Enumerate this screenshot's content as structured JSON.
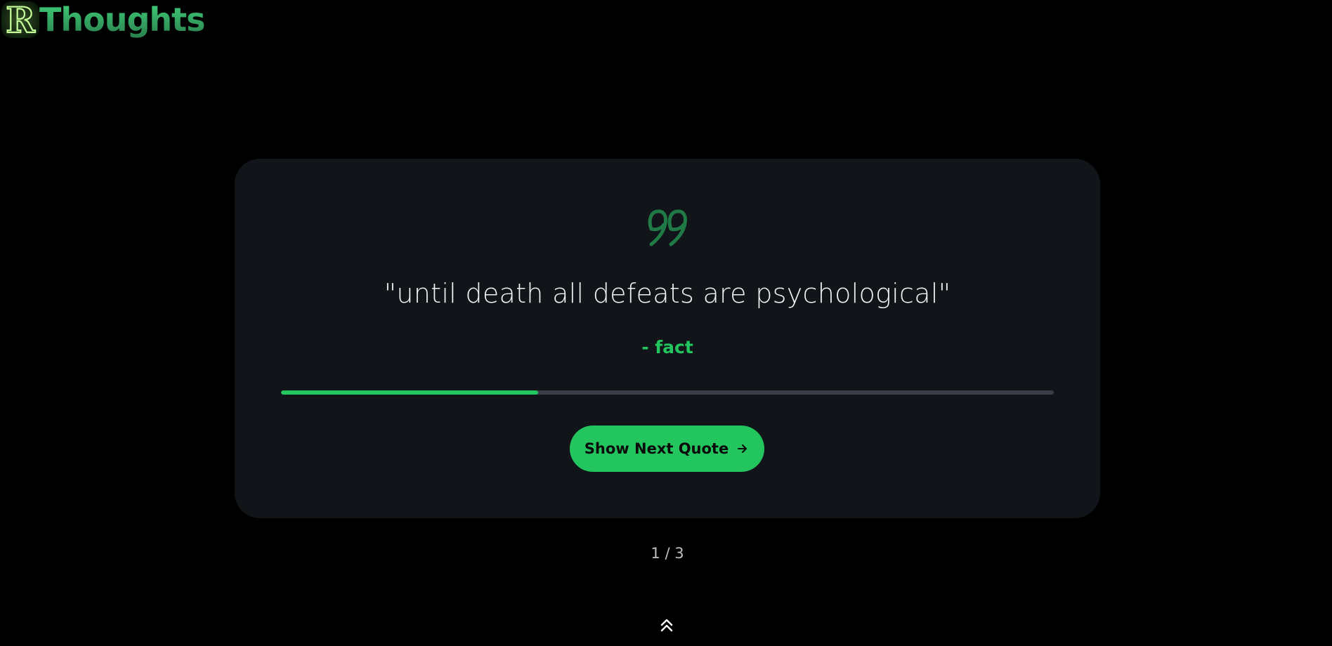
{
  "brand": {
    "logo_letter": "R",
    "name": "Thoughts"
  },
  "quote": {
    "icon": "quote-icon",
    "text": "\"until death all defeats are psychological\"",
    "author": "- fact"
  },
  "progress": {
    "fraction": 0.333
  },
  "actions": {
    "next_label": "Show Next Quote",
    "next_icon": "arrow-right-icon"
  },
  "pagination": {
    "counter": "1 / 3"
  },
  "scroll_top": {
    "icon": "double-chevron-up-icon"
  },
  "colors": {
    "accent": "#22c55e",
    "background": "#000000",
    "card": "#111418",
    "track": "#3a3d47",
    "quote_icon": "#1f7a45"
  }
}
